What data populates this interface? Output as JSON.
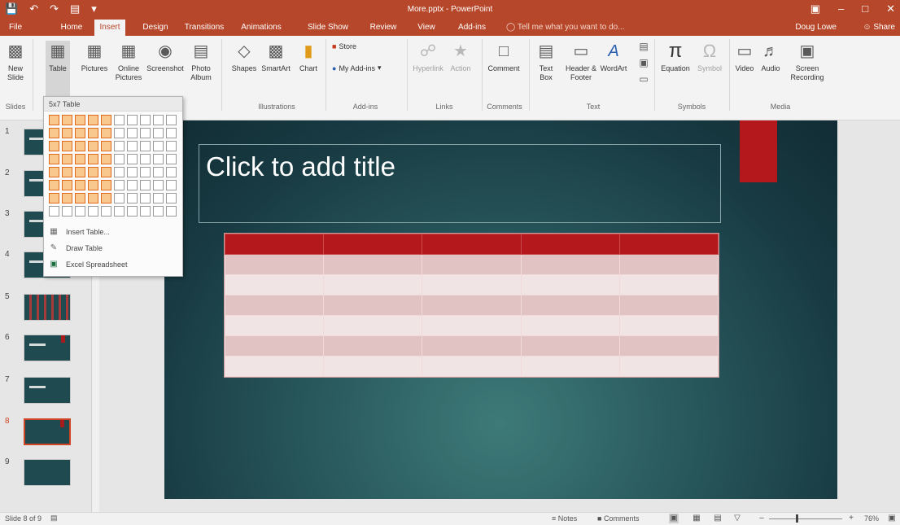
{
  "app": {
    "window_title": "More.pptx - PowerPoint",
    "user": "Doug Lowe",
    "share": "Share",
    "window_buttons": [
      "ribbon-display-icon",
      "minimize-icon",
      "maximize-icon",
      "close-icon"
    ]
  },
  "tabs": [
    {
      "label": "File"
    },
    {
      "label": "Home"
    },
    {
      "label": "Insert",
      "active": true
    },
    {
      "label": "Design"
    },
    {
      "label": "Transitions"
    },
    {
      "label": "Animations"
    },
    {
      "label": "Slide Show"
    },
    {
      "label": "Review"
    },
    {
      "label": "View"
    },
    {
      "label": "Add-ins"
    }
  ],
  "tell_me": "Tell me what you want to do...",
  "ribbon": {
    "new_slide": "New Slide",
    "table": "Table",
    "pictures": "Pictures",
    "online_pictures": "Online Pictures",
    "screenshot": "Screenshot",
    "photo_album": "Photo Album",
    "shapes": "Shapes",
    "smartart": "SmartArt",
    "chart": "Chart",
    "store": "Store",
    "my_addins": "My Add-ins",
    "hyperlink": "Hyperlink",
    "action": "Action",
    "comment": "Comment",
    "text_box": "Text Box",
    "header_footer": "Header & Footer",
    "wordart": "WordArt",
    "equation": "Equation",
    "symbol": "Symbol",
    "video": "Video",
    "audio": "Audio",
    "screen_recording": "Screen Recording",
    "groups": {
      "slides": "Slides",
      "illustrations": "Illustrations",
      "addins": "Add-ins",
      "links": "Links",
      "comments": "Comments",
      "text": "Text",
      "symbols": "Symbols",
      "media": "Media"
    }
  },
  "table_dropdown": {
    "header": "5x7 Table",
    "grid_cols": 10,
    "grid_rows": 8,
    "selected_cols": 5,
    "selected_rows": 7,
    "items": [
      {
        "label": "Insert Table...",
        "icon": "table-icon"
      },
      {
        "label": "Draw Table",
        "icon": "pencil-icon"
      },
      {
        "label": "Excel Spreadsheet",
        "icon": "excel-icon"
      }
    ]
  },
  "slides": {
    "numbers": [
      "1",
      "2",
      "3",
      "4",
      "5",
      "6",
      "7",
      "8",
      "9"
    ],
    "selected": "8"
  },
  "slide": {
    "title_placeholder": "Click to add title",
    "table_cols": 5,
    "table_rows": 7,
    "colors": {
      "header": "#b5181c",
      "band_dark": "#e2c3c3",
      "band_light": "#f1e4e4"
    }
  },
  "status": {
    "slide_of": "Slide 8 of 9",
    "notes": "Notes",
    "comments": "Comments",
    "zoom": "76%"
  },
  "colors": {
    "accent": "#b7472a",
    "grid_highlight": "#f8c88e"
  }
}
